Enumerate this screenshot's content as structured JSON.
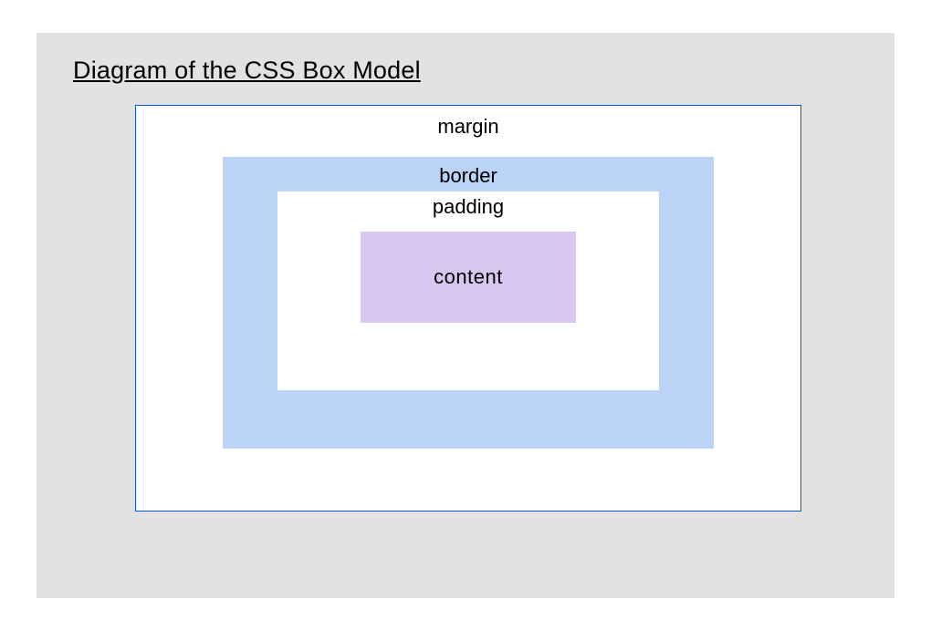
{
  "title": "Diagram of the CSS Box Model",
  "diagram": {
    "margin_label": "margin",
    "border_label": "border",
    "padding_label": "padding",
    "content_label": "content",
    "colors": {
      "panel_bg": "#e2e2e2",
      "margin_bg": "#ffffff",
      "margin_border": "#0a57d6",
      "border_bg": "#bad3f7",
      "padding_bg": "#ffffff",
      "content_bg": "#d8c8f1"
    }
  },
  "chart_data": {
    "type": "diagram",
    "title": "Diagram of the CSS Box Model",
    "layers": [
      {
        "name": "margin",
        "fill": "#ffffff",
        "border": "#0a57d6"
      },
      {
        "name": "border",
        "fill": "#bad3f7"
      },
      {
        "name": "padding",
        "fill": "#ffffff"
      },
      {
        "name": "content",
        "fill": "#d8c8f1"
      }
    ]
  }
}
